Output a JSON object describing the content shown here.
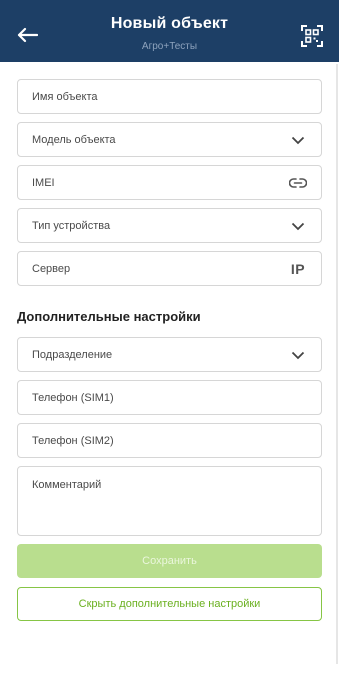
{
  "header": {
    "title": "Новый объект",
    "subtitle": "Агро+Тесты",
    "back_icon": "arrow-left-icon",
    "scan_icon": "qr-scan-icon"
  },
  "form": {
    "object_name": {
      "placeholder": "Имя объекта",
      "value": ""
    },
    "object_model": {
      "placeholder": "Модель объекта",
      "value": "",
      "icon": "chevron-down-icon"
    },
    "imei": {
      "placeholder": "IMEI",
      "value": "",
      "icon": "link-icon"
    },
    "device_type": {
      "placeholder": "Тип устройства",
      "value": "",
      "icon": "chevron-down-icon"
    },
    "server": {
      "placeholder": "Сервер",
      "value": "",
      "icon_text": "IP"
    }
  },
  "additional": {
    "title": "Дополнительные настройки",
    "division": {
      "placeholder": "Подразделение",
      "value": "",
      "icon": "chevron-down-icon"
    },
    "phone_sim1": {
      "placeholder": "Телефон (SIM1)",
      "value": ""
    },
    "phone_sim2": {
      "placeholder": "Телефон (SIM2)",
      "value": ""
    },
    "comment": {
      "placeholder": "Комментарий",
      "value": ""
    }
  },
  "actions": {
    "save_label": "Сохранить",
    "hide_additional_label": "Скрыть дополнительные настройки"
  },
  "colors": {
    "header_bg": "#1d3f66",
    "accent_green": "#86c545",
    "save_disabled": "#b9de8e"
  }
}
